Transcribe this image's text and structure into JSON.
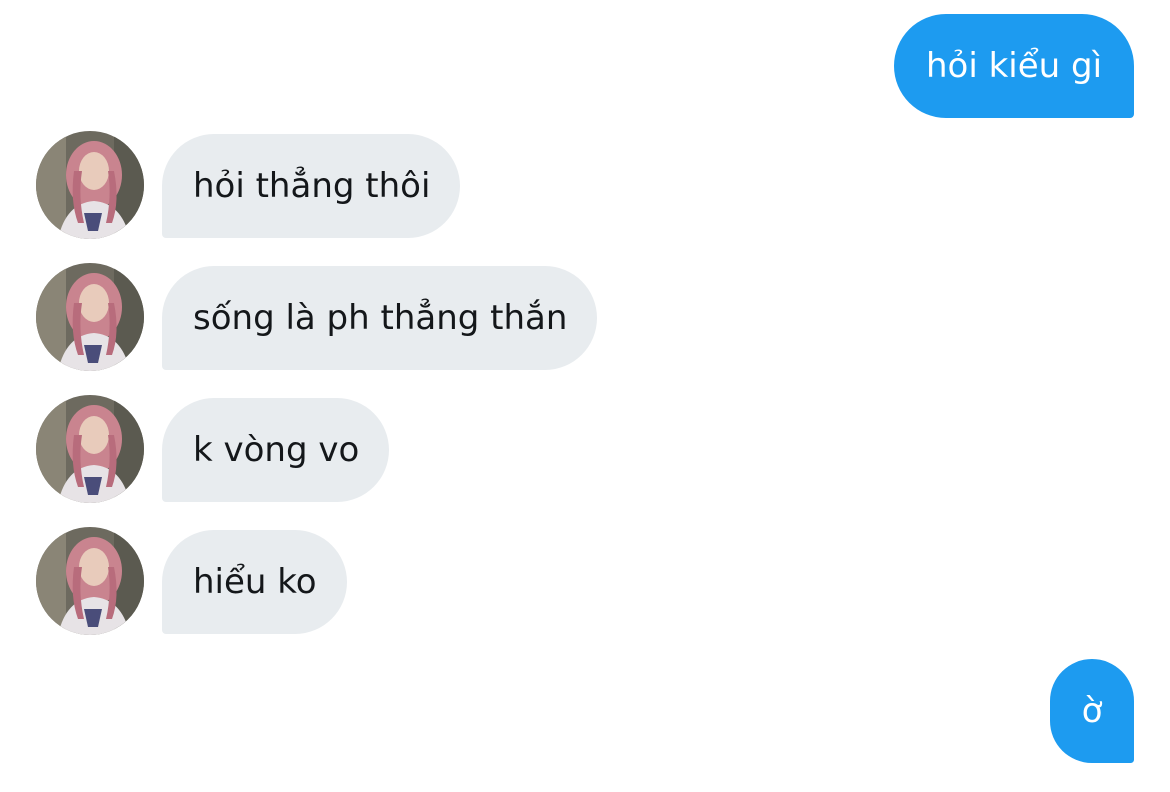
{
  "conversation": {
    "messages": [
      {
        "side": "sent",
        "text": "hỏi kiểu gì"
      },
      {
        "side": "received",
        "text": "hỏi thẳng thôi",
        "avatar": "user-avatar"
      },
      {
        "side": "received",
        "text": "sống là ph thẳng thắn",
        "avatar": "user-avatar"
      },
      {
        "side": "received",
        "text": "k vòng vo",
        "avatar": "user-avatar"
      },
      {
        "side": "received",
        "text": "hiểu ko",
        "avatar": "user-avatar"
      },
      {
        "side": "sent",
        "text": "ờ"
      }
    ]
  },
  "colors": {
    "sent_bubble": "#1d9bf0",
    "received_bubble": "#e8ecef",
    "received_text": "#14171a",
    "sent_text": "#ffffff"
  }
}
